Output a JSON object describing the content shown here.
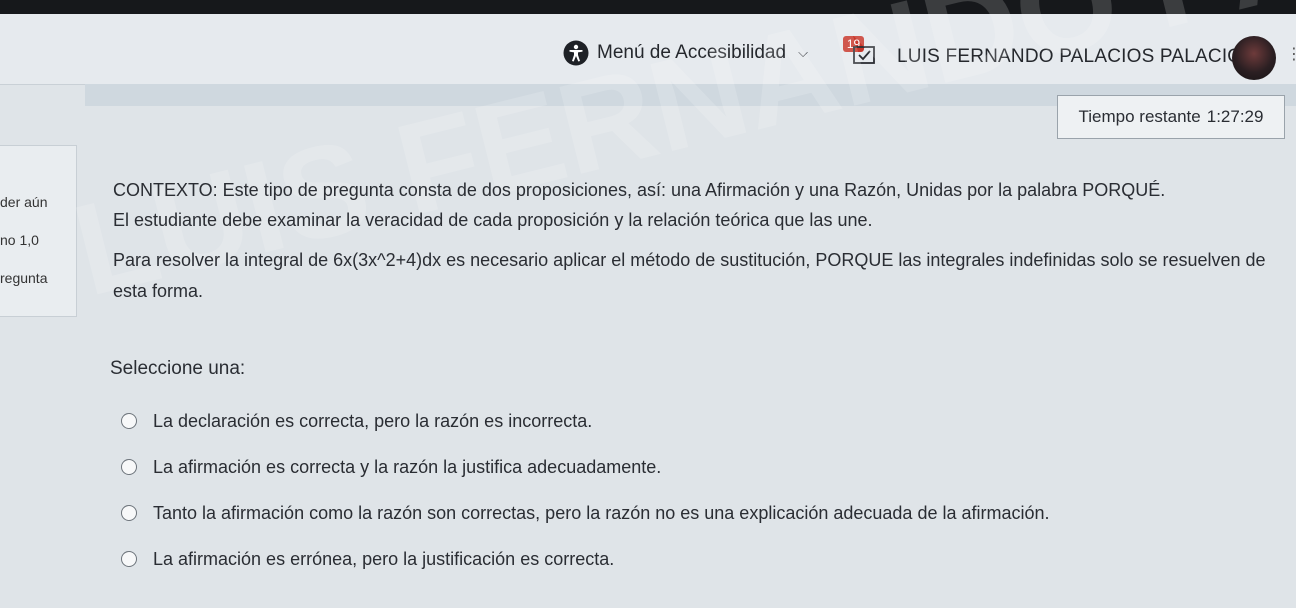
{
  "navbar": {
    "accessibility_menu": "Menú de Accesibilidad",
    "notification_count": "19",
    "user_name": "LUIS FERNANDO PALACIOS PALACIOS"
  },
  "timer": {
    "label": "Tiempo restante",
    "value": "1:27:29"
  },
  "left_panel": {
    "status": "der aún",
    "score": "no 1,0",
    "flag": "regunta"
  },
  "question": {
    "context_line1": "CONTEXTO: Este tipo de pregunta consta de dos proposiciones, así: una Afirmación y una Razón, Unidas por la palabra PORQUÉ.",
    "context_line2": "El estudiante debe examinar la veracidad de cada proposición y la relación teórica que las une.",
    "statement_prefix": "Para resolver la integral de ",
    "statement_math": "6x(3x^2+4)dx",
    "statement_suffix": " es necesario aplicar el método de sustitución, PORQUE las integrales indefinidas solo se resuelven de esta forma.",
    "select_label": "Seleccione una:",
    "options": [
      "La declaración es correcta, pero la razón es incorrecta.",
      "La afirmación es correcta y la razón la justifica adecuadamente.",
      "Tanto la afirmación como la razón son correctas, pero la razón no es una explicación adecuada de la afirmación.",
      "La afirmación es errónea, pero la justificación es correcta."
    ]
  },
  "watermark": "LUIS FERNANDO PALACIOS",
  "colors": {
    "background": "#dfe4e8",
    "badge": "#c8372b",
    "text": "#2a2d33"
  }
}
